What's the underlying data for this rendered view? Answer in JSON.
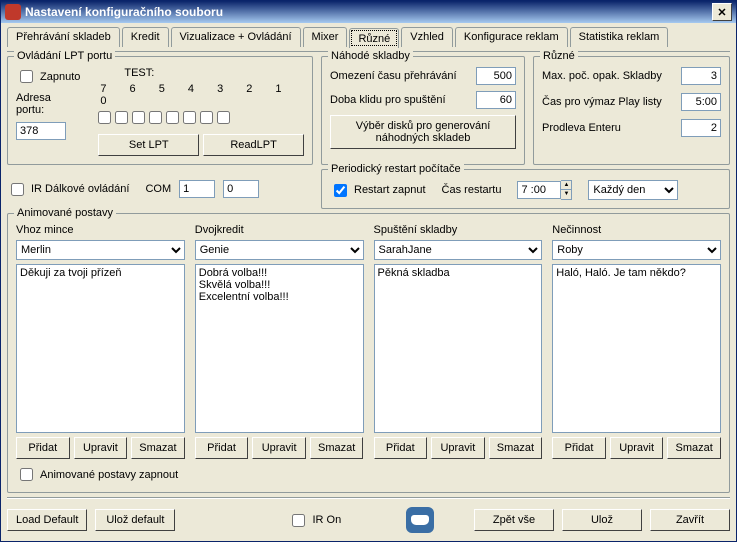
{
  "window": {
    "title": "Nastavení konfiguračního souboru"
  },
  "tabs": [
    "Přehrávání skladeb",
    "Kredit",
    "Vizualizace + Ovládání",
    "Mixer",
    "Různé",
    "Vzhled",
    "Konfigurace reklam",
    "Statistika reklam"
  ],
  "lpt": {
    "legend": "Ovládání LPT portu",
    "enabled_label": "Zapnuto",
    "test_label": "TEST:",
    "bits_label": "7  6  5  4  3  2  1  0",
    "address_label": "Adresa portu:",
    "address_value": "378",
    "set_btn": "Set LPT",
    "read_btn": "ReadLPT"
  },
  "random": {
    "legend": "Náhodé skladby",
    "limit_label": "Omezení času přehrávání",
    "limit_value": "500",
    "idle_label": "Doba klidu pro spuštění",
    "idle_value": "60",
    "select_btn": "Výběr disků pro generování\nnáhodných skladeb"
  },
  "misc": {
    "legend": "Různé",
    "max_label": "Max. poč. opak. Skladby",
    "max_value": "3",
    "clear_label": "Čas pro výmaz Play listy",
    "clear_value": "5:00",
    "enter_label": "Prodleva Enteru",
    "enter_value": "2"
  },
  "ir": {
    "label": "IR Dálkové ovládání",
    "com_label": "COM",
    "com_value": "1",
    "irq_value": "0"
  },
  "restart": {
    "legend": "Periodický restart počítače",
    "enabled_label": "Restart zapnut",
    "time_label": "Čas restartu",
    "time_value": "7 :00",
    "mode": "Každý den"
  },
  "anim": {
    "legend": "Animované postavy",
    "enable_label": "Animované postavy zapnout",
    "btn_add": "Přidat",
    "btn_edit": "Upravit",
    "btn_del": "Smazat",
    "cols": [
      {
        "title": "Vhoz mince",
        "char": "Merlin",
        "text": "Děkuji za tvoji přízeň"
      },
      {
        "title": "Dvojkredit",
        "char": "Genie",
        "text": "Dobrá volba!!!\nSkvělá volba!!!\nExcelentní volba!!!"
      },
      {
        "title": "Spuštění skladby",
        "char": "SarahJane",
        "text": "Pěkná skladba"
      },
      {
        "title": "Nečinnost",
        "char": "Roby",
        "text": "Haló, Haló. Je tam někdo?"
      }
    ]
  },
  "footer": {
    "load": "Load Default",
    "savedef": "Ulož default",
    "iron": "IR On",
    "revert": "Zpět vše",
    "save": "Ulož",
    "close": "Zavřít"
  }
}
